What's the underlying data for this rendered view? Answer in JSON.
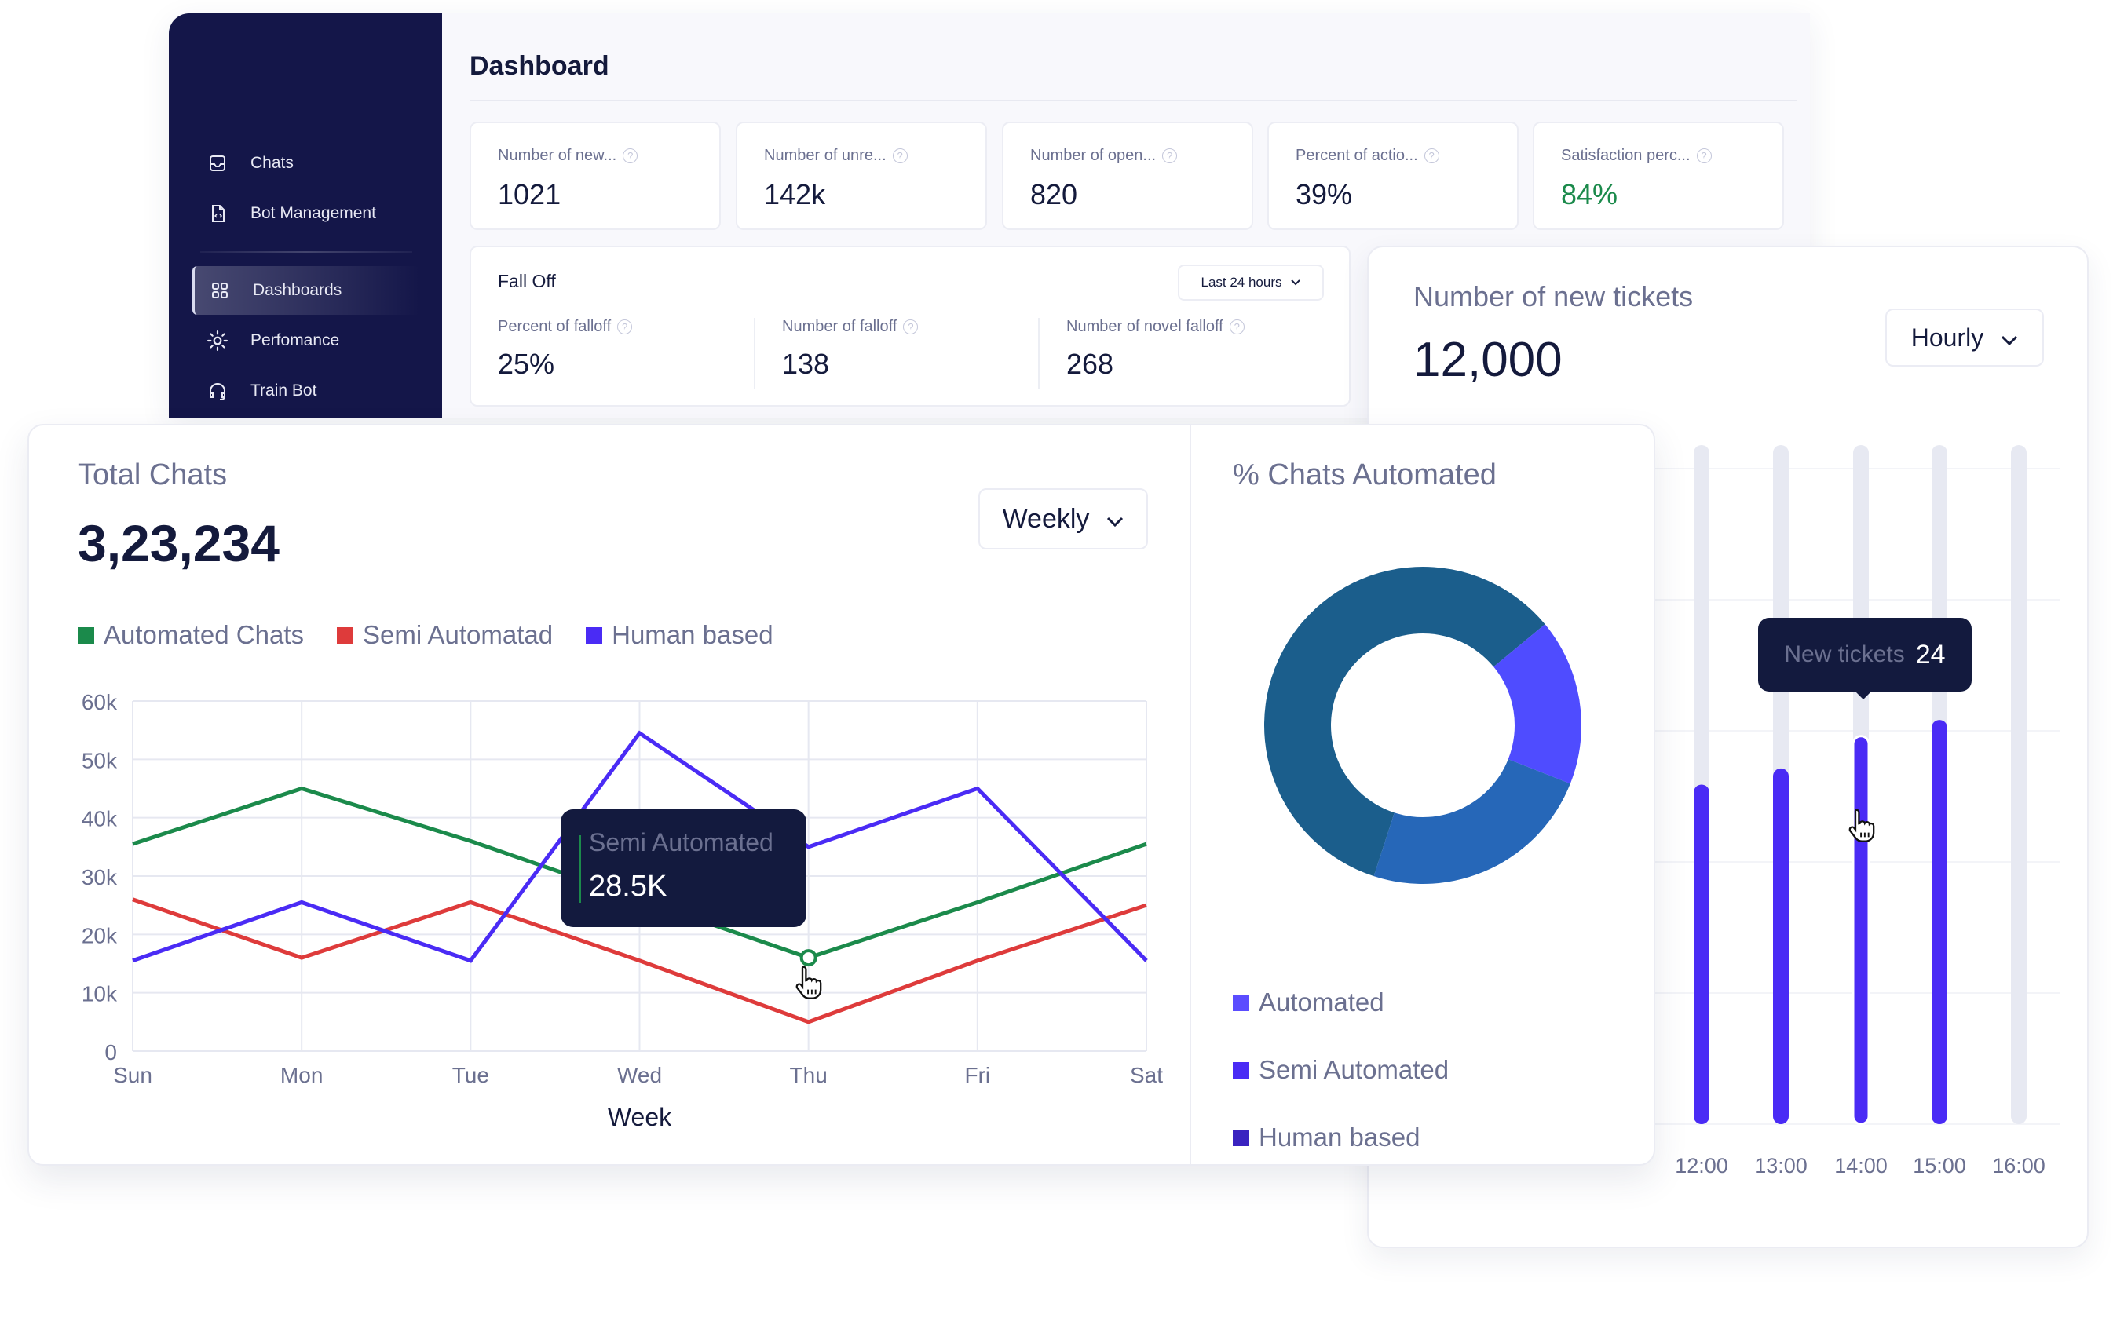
{
  "sidebar": {
    "items": [
      {
        "label": "Chats",
        "icon": "inbox-icon",
        "active": false
      },
      {
        "label": "Bot Management",
        "icon": "code-file-icon",
        "active": false
      },
      {
        "label": "Dashboards",
        "icon": "grid-icon",
        "active": true
      },
      {
        "label": "Perfomance",
        "icon": "sun-icon",
        "active": false
      },
      {
        "label": "Train Bot",
        "icon": "headphones-icon",
        "active": false
      }
    ]
  },
  "dashboard": {
    "title": "Dashboard",
    "stats": [
      {
        "label": "Number of new...",
        "value": "1021"
      },
      {
        "label": "Number of unre...",
        "value": "142k"
      },
      {
        "label": "Number of open...",
        "value": "820"
      },
      {
        "label": "Percent of actio...",
        "value": "39%"
      },
      {
        "label": "Satisfaction perc...",
        "value": "84%",
        "color": "#1b8a4b"
      }
    ],
    "help_glyph": "?",
    "falloff": {
      "title": "Fall Off",
      "range": "Last 24 hours",
      "metrics": [
        {
          "label": "Percent of falloff",
          "value": "25%"
        },
        {
          "label": "Number of falloff",
          "value": "138"
        },
        {
          "label": "Number of novel falloff",
          "value": "268"
        }
      ]
    }
  },
  "tickets": {
    "title": "Number of new tickets",
    "value": "12,000",
    "period": "Hourly",
    "tooltip": {
      "label": "New tickets",
      "value": "24"
    }
  },
  "total_chats": {
    "title": "Total Chats",
    "value": "3,23,234",
    "period": "Weekly",
    "tooltip": {
      "label": "Semi Automated",
      "value": "28.5K"
    }
  },
  "chats_automated": {
    "title": "% Chats Automated",
    "legend": [
      {
        "label": "Automated",
        "color": "#5b4dff"
      },
      {
        "label": "Semi Automated",
        "color": "#4a2bf5"
      },
      {
        "label": "Human based",
        "color": "#3a23c0"
      }
    ]
  },
  "chart_data": [
    {
      "type": "line",
      "title": "Total Chats",
      "xlabel": "Week",
      "ylabel": "",
      "categories": [
        "Sun",
        "Mon",
        "Tue",
        "Wed",
        "Thu",
        "Fri",
        "Sat"
      ],
      "ylim": [
        0,
        60000
      ],
      "yticks": [
        0,
        10000,
        20000,
        30000,
        40000,
        50000,
        60000
      ],
      "ytick_labels": [
        "0",
        "10k",
        "20k",
        "30k",
        "40k",
        "50k",
        "60k"
      ],
      "grid": true,
      "legend_position": "top-left",
      "series": [
        {
          "name": "Automated Chats",
          "color": "#1b8a4b",
          "values": [
            35500,
            45000,
            36000,
            26000,
            16000,
            25500,
            35500
          ]
        },
        {
          "name": "Semi Automatad",
          "color": "#de3b3b",
          "values": [
            26000,
            16000,
            25500,
            15500,
            5000,
            15500,
            25000
          ]
        },
        {
          "name": "Human based",
          "color": "#4a2bf5",
          "values": [
            15500,
            25500,
            15500,
            54500,
            35000,
            45000,
            15500
          ]
        }
      ],
      "highlight": {
        "series": "Automated Chats",
        "category": "Thu"
      }
    },
    {
      "type": "pie",
      "title": "% Chats Automated",
      "donut": true,
      "slices": [
        {
          "name": "Automated",
          "value": 59,
          "color": "#1b5e8c"
        },
        {
          "name": "Semi Automated",
          "value": 17,
          "color": "#4f4cff"
        },
        {
          "name": "Human based",
          "value": 24,
          "color": "#2667b8"
        }
      ],
      "start_angle_deg": 198
    },
    {
      "type": "bar",
      "title": "Number of new tickets",
      "categories": [
        "12:00",
        "13:00",
        "14:00",
        "15:00",
        "16:00"
      ],
      "values": [
        21,
        22,
        24,
        25,
        0
      ],
      "ylim": [
        0,
        42
      ],
      "color": "#4a2bf5",
      "track_color": "#e7e9f2",
      "highlight": {
        "category": "14:00",
        "value": 24
      }
    }
  ]
}
